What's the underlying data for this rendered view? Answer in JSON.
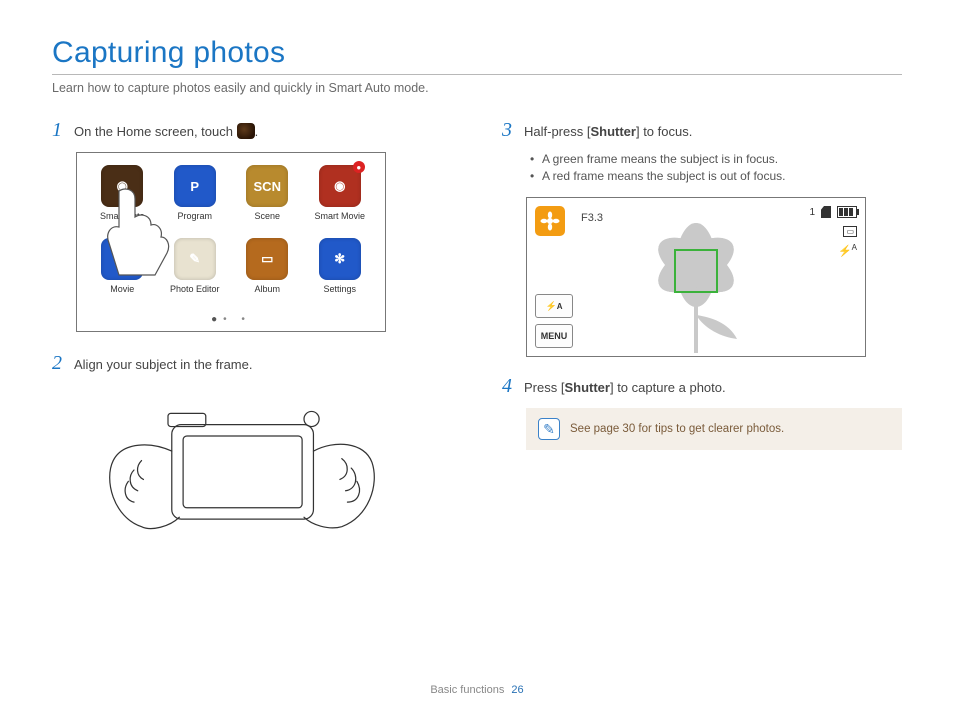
{
  "title": "Capturing photos",
  "subtitle": "Learn how to capture photos easily and quickly in Smart Auto mode.",
  "steps": {
    "s1": {
      "num": "1",
      "text_before": "On the Home screen, touch ",
      "text_after": "."
    },
    "s2": {
      "num": "2",
      "text": "Align your subject in the frame."
    },
    "s3": {
      "num": "3",
      "text_a": "Half-press [",
      "text_bold": "Shutter",
      "text_b": "] to focus."
    },
    "s3_bullets": [
      "A green frame means the subject is in focus.",
      "A red frame means the subject is out of focus."
    ],
    "s4": {
      "num": "4",
      "text_a": "Press [",
      "text_bold": "Shutter",
      "text_b": "] to capture a photo."
    }
  },
  "home_apps": [
    {
      "label": "Smart Auto",
      "color": "#4a2e16"
    },
    {
      "label": "Program",
      "color": "#2159c9"
    },
    {
      "label": "Scene",
      "color": "#b88a2e"
    },
    {
      "label": "Smart Movie",
      "color": "#b03020"
    },
    {
      "label": "Movie",
      "color": "#2159c9"
    },
    {
      "label": "Photo Editor",
      "color": "#e8e2d0"
    },
    {
      "label": "Album",
      "color": "#b56a1e"
    },
    {
      "label": "Settings",
      "color": "#2159c9"
    }
  ],
  "lcd": {
    "aperture": "F3.3",
    "shots": "1",
    "flash_label": "A",
    "menu_label": "MENU"
  },
  "note": "See page 30 for tips to get clearer photos.",
  "footer": {
    "section": "Basic functions",
    "page": "26"
  }
}
